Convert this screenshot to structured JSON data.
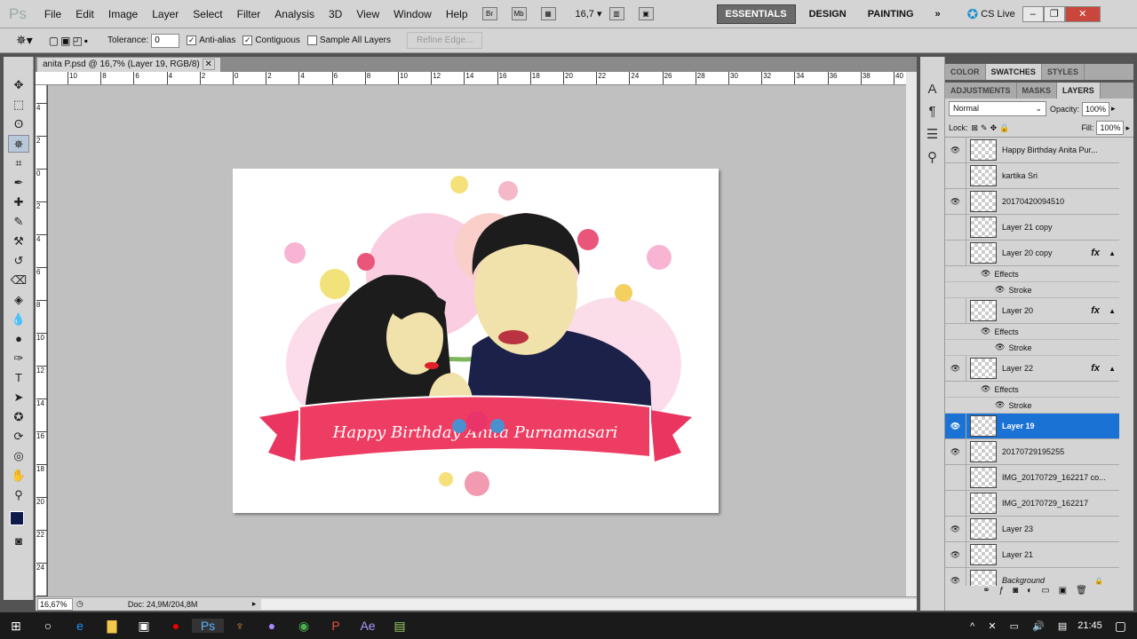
{
  "menubar": {
    "logo": "Ps",
    "items": [
      "File",
      "Edit",
      "Image",
      "Layer",
      "Select",
      "Filter",
      "Analysis",
      "3D",
      "View",
      "Window",
      "Help"
    ],
    "bridge": "Br",
    "minibridge": "Mb",
    "zoom": "16,7",
    "workspaces": [
      "ESSENTIALS",
      "DESIGN",
      "PAINTING"
    ],
    "more": "»",
    "cslive": "CS Live"
  },
  "options": {
    "tolerance_label": "Tolerance:",
    "tolerance_value": "0",
    "anti_alias": "Anti-alias",
    "anti_alias_checked": true,
    "contiguous": "Contiguous",
    "contiguous_checked": true,
    "sample_all": "Sample All Layers",
    "sample_all_checked": false,
    "refine_edge": "Refine Edge..."
  },
  "document": {
    "tab_title": "anita P.psd @ 16,7% (Layer 19, RGB/8)",
    "ruler_h": [
      "10",
      "8",
      "6",
      "4",
      "2",
      "0",
      "2",
      "4",
      "6",
      "8",
      "10",
      "12",
      "14",
      "16",
      "18",
      "20",
      "22",
      "24",
      "26",
      "28",
      "30",
      "32",
      "34",
      "36",
      "38",
      "40"
    ],
    "ruler_v": [
      "4",
      "2",
      "0",
      "2",
      "4",
      "6",
      "8",
      "10",
      "12",
      "14",
      "16",
      "18",
      "20",
      "22",
      "24",
      "26"
    ],
    "banner_text": "Happy Birthday Anita Purnamasari"
  },
  "status": {
    "zoom": "16,67%",
    "doc": "Doc: 24,9M/204,8M"
  },
  "panels": {
    "top_tabs": [
      "COLOR",
      "SWATCHES",
      "STYLES"
    ],
    "top_active": "SWATCHES",
    "tabs": [
      "ADJUSTMENTS",
      "MASKS",
      "LAYERS"
    ],
    "active": "LAYERS",
    "blend_mode": "Normal",
    "opacity_label": "Opacity:",
    "opacity": "100%",
    "lock_label": "Lock:",
    "fill_label": "Fill:",
    "fill": "100%",
    "layers": [
      {
        "name": "Happy Birthday Anita Pur...",
        "visible": true
      },
      {
        "name": "kartika Sri",
        "visible": false
      },
      {
        "name": "20170420094510",
        "visible": true
      },
      {
        "name": "Layer 21 copy",
        "visible": false
      },
      {
        "name": "Layer 20 copy",
        "visible": false,
        "fx": true,
        "effects": "Effects",
        "stroke": "Stroke"
      },
      {
        "name": "Layer 20",
        "visible": false,
        "fx": true,
        "effects": "Effects",
        "stroke": "Stroke"
      },
      {
        "name": "Layer 22",
        "visible": true,
        "fx": true,
        "effects": "Effects",
        "stroke": "Stroke"
      },
      {
        "name": "Layer 19",
        "visible": true,
        "selected": true
      },
      {
        "name": "20170729195255",
        "visible": true
      },
      {
        "name": "IMG_20170729_162217 co...",
        "visible": false
      },
      {
        "name": "IMG_20170729_162217",
        "visible": false
      },
      {
        "name": "Layer 23",
        "visible": true
      },
      {
        "name": "Layer 21",
        "visible": true
      },
      {
        "name": "Background",
        "visible": true,
        "locked": true
      }
    ]
  },
  "taskbar": {
    "time": "21:45"
  },
  "colors": {
    "selection": "#1a73d4",
    "banner": "#ee3d63",
    "foreground": "#0d1a4a"
  }
}
